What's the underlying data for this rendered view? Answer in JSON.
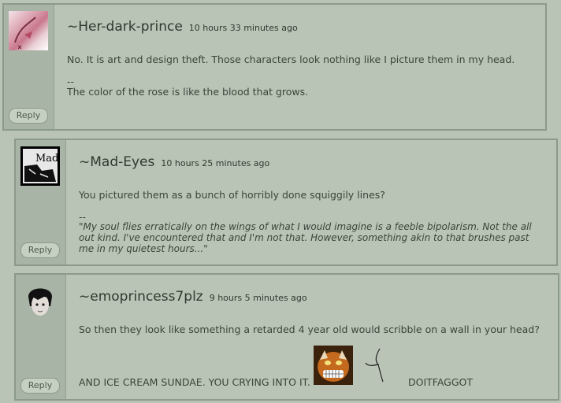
{
  "comments": [
    {
      "username": "~Her-dark-prince",
      "time": "10 hours 33 minutes ago",
      "text": "No. It is art and design theft. Those characters look nothing like I picture them in my head.",
      "sig_dash": "--",
      "sig_lines": [
        "The color of the rose is like the blood that grows."
      ],
      "reply_label": "Reply"
    },
    {
      "username": "~Mad-Eyes",
      "time": "10 hours 25 minutes ago",
      "text": "You pictured them as a bunch of horribly done squiggily lines?",
      "sig_dash": "--",
      "sig_lines": [
        "\"My soul flies erratically on the wings of what I would imagine is a feeble bipolarism. Not the all",
        "out kind. I've encountered that and I'm not that. However, something akin to that brushes past",
        "me in my quietest hours...\""
      ],
      "avatar_text": "Mad",
      "reply_label": "Reply"
    },
    {
      "username": "~emoprincess7plz",
      "time": "9 hours 5 minutes ago",
      "text": "So then they look like something a retarded 4 year old would scribble on a wall in your head?",
      "line2_a": "AND ICE CREAM SUNDAE. YOU CRYING INTO IT.",
      "line2_b": "DOITFAGGOT",
      "reply_label": "Reply"
    }
  ],
  "colors": {
    "background": "#b9c4b6",
    "sidebar": "#a8b4a5",
    "border": "#8c9a8a",
    "text": "#3a4438"
  }
}
